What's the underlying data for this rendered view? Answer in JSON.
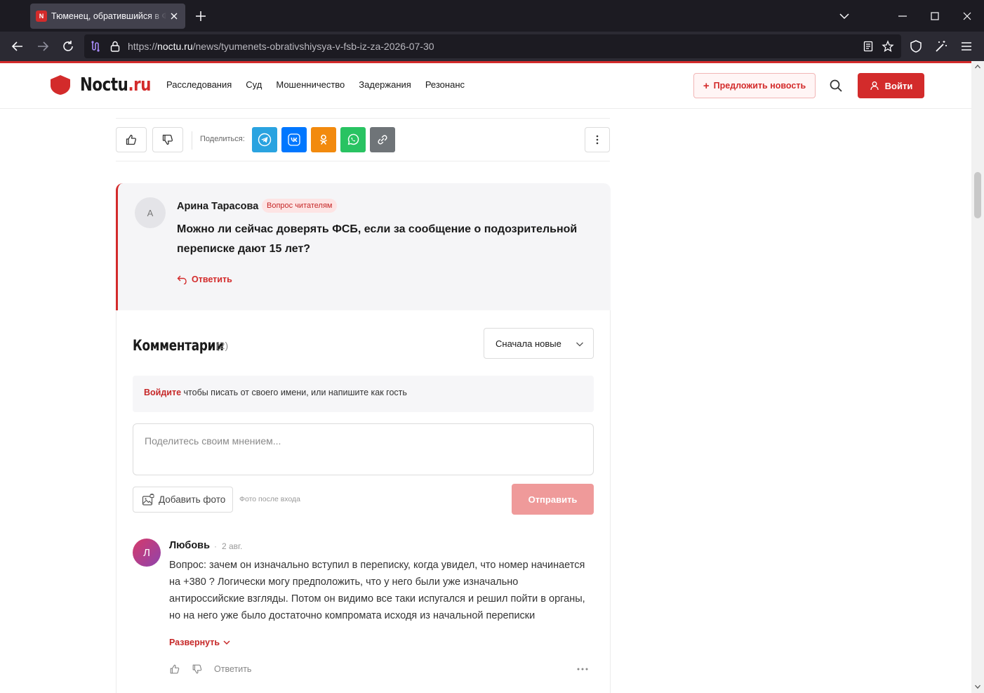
{
  "browser": {
    "tab_title": "Тюменец, обратившийся в ФСБ из-за",
    "tab_favicon_letter": "N",
    "url_scheme": "https://",
    "url_host": "noctu.ru",
    "url_path": "/news/tyumenets-obrativshiysya-v-fsb-iz-za-2026-07-30",
    "icons": [
      "back-icon",
      "forward-icon",
      "reload-icon",
      "lock-icon",
      "reader-icon",
      "bookmark-star-icon",
      "shield-icon",
      "extensions-icon",
      "menu-icon"
    ]
  },
  "site": {
    "logo_main": "Noctu",
    "logo_accent": ".ru",
    "brand_color": "#d32b2b",
    "menu": [
      "Расследования",
      "Суд",
      "Мошенничество",
      "Задержания",
      "Резонанс"
    ],
    "suggest_label": "Предложить новость",
    "login_label": "Войти"
  },
  "share": {
    "label": "Поделиться:",
    "buttons": [
      {
        "name": "telegram",
        "color": "#2aa3e0"
      },
      {
        "name": "vk",
        "color": "#0077ff"
      },
      {
        "name": "odnoklassniki",
        "color": "#f28a0e"
      },
      {
        "name": "whatsapp",
        "color": "#29c362"
      },
      {
        "name": "copy-link",
        "color": "#6f7478"
      }
    ]
  },
  "question": {
    "avatar_letter": "А",
    "author": "Арина Тарасова",
    "badge": "Вопрос читателям",
    "text": "Можно ли сейчас доверять ФСБ, если за сообщение о подозрительной переписке дают 15 лет?",
    "reply_label": "Ответить"
  },
  "comments": {
    "title": "Комментарии",
    "count": "(2)",
    "sort_selected": "Сначала новые",
    "login_hint_link": "Войдите",
    "login_hint_text": " чтобы писать от своего имени, или напишите как гость",
    "input_placeholder": "Поделитесь своим мнением...",
    "add_photo_label": "Добавить фото",
    "photo_note": "Фото после входа",
    "send_label": "Отправить",
    "items": [
      {
        "avatar_letter": "Л",
        "author": "Любовь",
        "dot": "·",
        "date": "2 авг.",
        "text": "Вопрос: зачем он изначально вступил в переписку, когда увидел, что номер начинается на +380 ? Логически могу предположить, что у него были уже изначально антироссийские взгляды. Потом он видимо все таки испугался и решил пойти в органы, но на него уже было достаточно компромата исходя из начальной переписки",
        "expand_label": "Развернуть",
        "reply_label": "Ответить"
      }
    ]
  }
}
